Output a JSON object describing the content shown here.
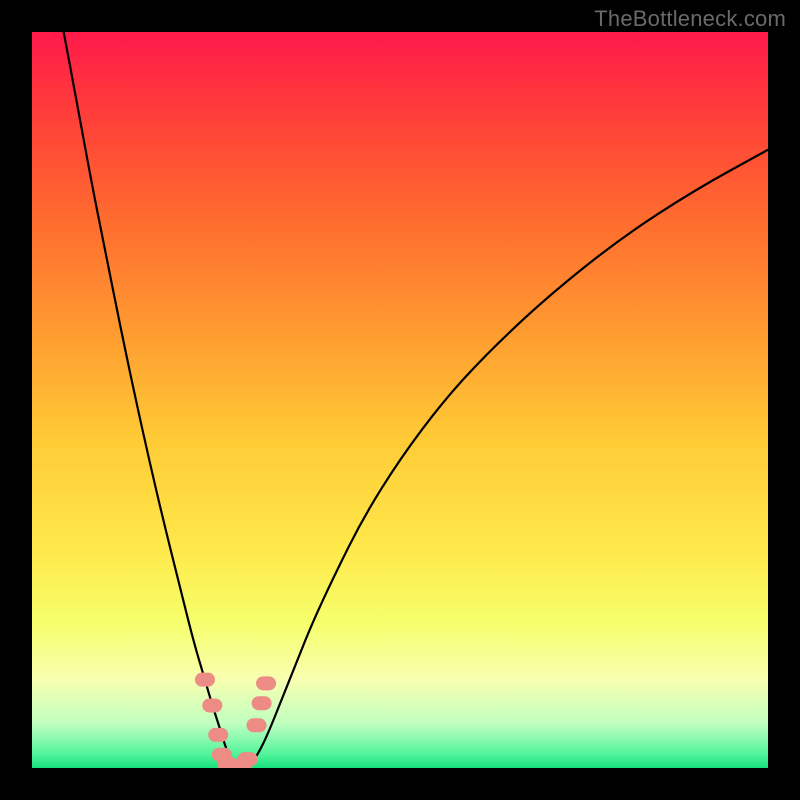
{
  "watermark": "TheBottleneck.com",
  "chart_data": {
    "type": "line",
    "title": "",
    "xlabel": "",
    "ylabel": "",
    "xlim": [
      0,
      100
    ],
    "ylim": [
      0,
      100
    ],
    "grid": false,
    "legend": false,
    "description": "V-shaped bottleneck curve over a vertical rainbow gradient. Minimum (optimum) occurs near x ≈ 27, y ≈ 0.",
    "gradient_stops": [
      {
        "offset": 0.0,
        "color": "#ff1a4b"
      },
      {
        "offset": 0.1,
        "color": "#ff3a3a"
      },
      {
        "offset": 0.25,
        "color": "#ff6a2f"
      },
      {
        "offset": 0.4,
        "color": "#ff9930"
      },
      {
        "offset": 0.55,
        "color": "#ffca35"
      },
      {
        "offset": 0.7,
        "color": "#ffe84a"
      },
      {
        "offset": 0.8,
        "color": "#f6ff6a"
      },
      {
        "offset": 0.88,
        "color": "#f8ffb0"
      },
      {
        "offset": 0.94,
        "color": "#c0ffc0"
      },
      {
        "offset": 0.98,
        "color": "#55f59d"
      },
      {
        "offset": 1.0,
        "color": "#18e07a"
      }
    ],
    "series": [
      {
        "name": "bottleneck-curve",
        "x": [
          4.3,
          6,
          8,
          10,
          12,
          14,
          16,
          18,
          20,
          22,
          23.5,
          24.5,
          25.5,
          26.5,
          27.5,
          28.5,
          29.5,
          30.5,
          32,
          34,
          36,
          38,
          41,
          45,
          50,
          56,
          62,
          70,
          80,
          90,
          100
        ],
        "y": [
          100,
          91,
          80,
          70,
          60,
          50.5,
          41.5,
          33,
          25,
          17,
          12,
          8.5,
          5.5,
          2.2,
          0.3,
          0.1,
          0.5,
          1.5,
          4.5,
          9.5,
          14.5,
          19.5,
          26,
          34,
          42,
          50,
          56.5,
          64,
          72,
          78.5,
          84
        ]
      }
    ],
    "markers": [
      {
        "x": 23.5,
        "y": 12.0
      },
      {
        "x": 24.5,
        "y": 8.5
      },
      {
        "x": 25.3,
        "y": 4.5
      },
      {
        "x": 25.8,
        "y": 1.8
      },
      {
        "x": 26.5,
        "y": 0.6
      },
      {
        "x": 27.5,
        "y": 0.3
      },
      {
        "x": 28.5,
        "y": 0.3
      },
      {
        "x": 29.3,
        "y": 1.2
      },
      {
        "x": 30.5,
        "y": 5.8
      },
      {
        "x": 31.2,
        "y": 8.8
      },
      {
        "x": 31.8,
        "y": 11.5
      }
    ]
  }
}
